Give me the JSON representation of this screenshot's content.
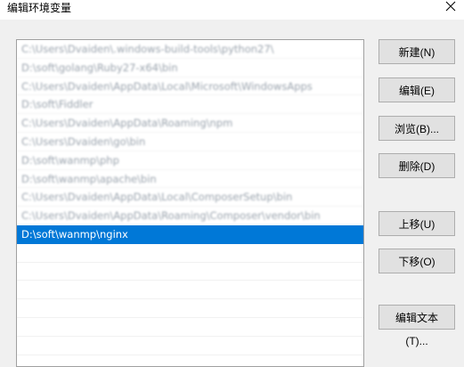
{
  "window": {
    "title": "编辑环境变量",
    "close_icon": "close-icon"
  },
  "path_list": {
    "items": [
      {
        "text": "C:\\Users\\Dvaiden\\.windows-build-tools\\python27\\",
        "state": "blurred"
      },
      {
        "text": "D:\\soft\\golang\\Ruby27-x64\\bin",
        "state": "blurred"
      },
      {
        "text": "C:\\Users\\Dvaiden\\AppData\\Local\\Microsoft\\WindowsApps",
        "state": "blurred"
      },
      {
        "text": "D:\\soft\\Fiddler",
        "state": "blurred"
      },
      {
        "text": "C:\\Users\\Dvaiden\\AppData\\Roaming\\npm",
        "state": "blurred"
      },
      {
        "text": "C:\\Users\\Dvaiden\\go\\bin",
        "state": "blurred"
      },
      {
        "text": "D:\\soft\\wanmp\\php",
        "state": "blurred"
      },
      {
        "text": "D:\\soft\\wanmp\\apache\\bin",
        "state": "blurred"
      },
      {
        "text": "C:\\Users\\Dvaiden\\AppData\\Local\\ComposerSetup\\bin",
        "state": "blurred"
      },
      {
        "text": "C:\\Users\\Dvaiden\\AppData\\Roaming\\Composer\\vendor\\bin",
        "state": "blurred"
      },
      {
        "text": "D:\\soft\\wanmp\\nginx",
        "state": "selected"
      },
      {
        "text": "",
        "state": "empty"
      },
      {
        "text": "",
        "state": "empty"
      },
      {
        "text": "",
        "state": "empty"
      },
      {
        "text": "",
        "state": "empty"
      },
      {
        "text": "",
        "state": "empty"
      },
      {
        "text": "",
        "state": "empty"
      },
      {
        "text": "",
        "state": "empty"
      }
    ]
  },
  "buttons": {
    "new": "新建(N)",
    "edit": "编辑(E)",
    "browse": "浏览(B)...",
    "delete": "删除(D)",
    "move_up": "上移(U)",
    "move_down": "下移(O)",
    "edit_text": "编辑文本(T)..."
  },
  "colors": {
    "selection": "#0078d7",
    "window_bg": "#f0f0f0",
    "button_bg": "#e1e1e1"
  }
}
